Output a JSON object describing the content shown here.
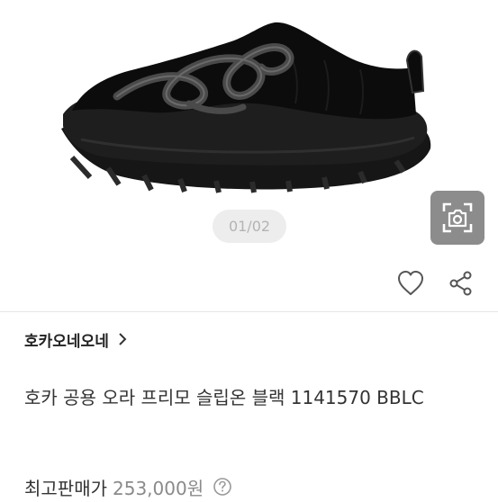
{
  "gallery": {
    "page_indicator": "01/02",
    "lens_icon": "lens-search-icon"
  },
  "actions": {
    "like_icon": "heart-icon",
    "share_icon": "share-icon"
  },
  "brand": {
    "name": "호카오네오네",
    "chevron": "›"
  },
  "product": {
    "title": "호카 공용 오라 프리모 슬립온 블랙 1141570 BBLC"
  },
  "price": {
    "label": "최고판매가",
    "value": "253,000원",
    "help_icon": "question-circle-icon"
  },
  "colors": {
    "accent_gray": "#8c8c8c",
    "indicator_bg": "#ededed"
  }
}
